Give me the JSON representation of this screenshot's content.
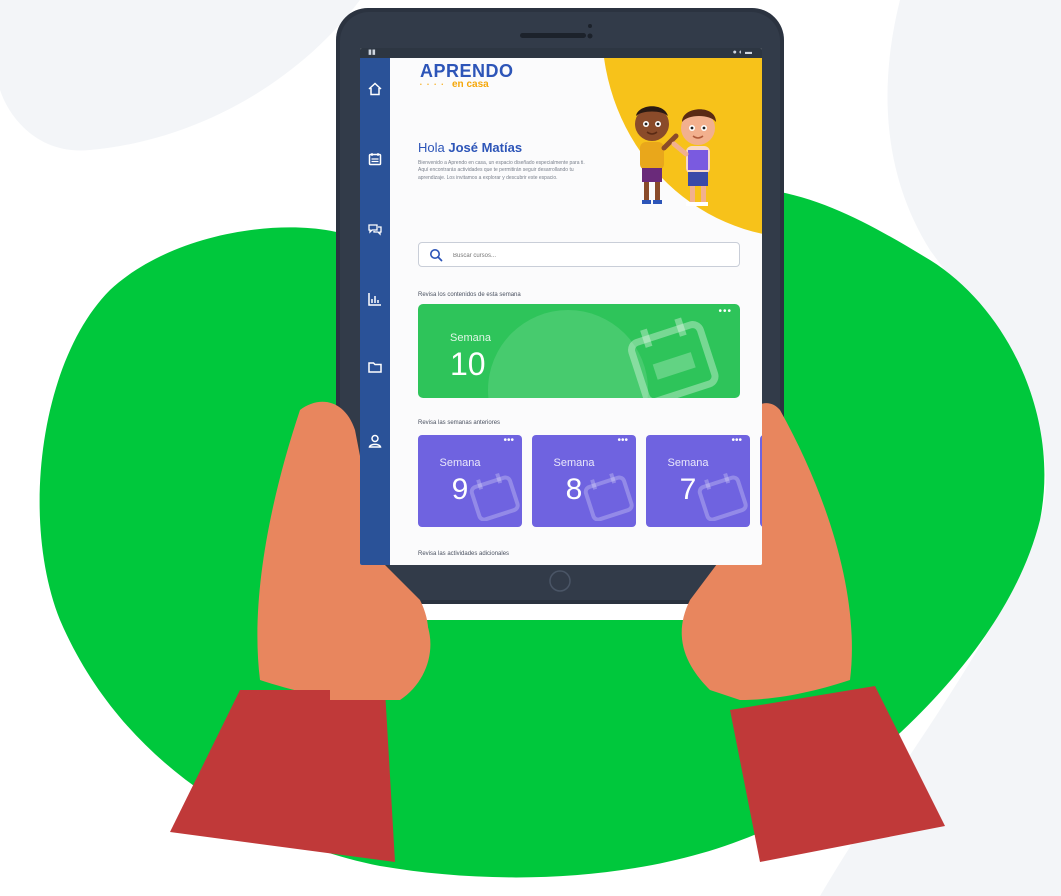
{
  "app": {
    "logo_main": "APRENDO",
    "logo_sub": "en casa"
  },
  "header": {
    "greeting_prefix": "Hola ",
    "user_name": "José Matías",
    "intro_text": "Bienvenido a Aprendo en casa, un espacio diseñado especialmente para ti. Aquí encontrarás actividades que te permitirán seguir desarrollando tu aprendizaje. Los invitamos a explorar y descubrir este espacio."
  },
  "search": {
    "placeholder": "Buscar cursos..."
  },
  "sections": {
    "current_week_label": "Revisa los contenidos de esta semana",
    "previous_weeks_label": "Revisa las semanas anteriores",
    "additional_label": "Revisa las actividades adicionales"
  },
  "current_week": {
    "label": "Semana",
    "number": "10",
    "more": "•••"
  },
  "previous_weeks": [
    {
      "label": "Semana",
      "number": "9",
      "more": "•••"
    },
    {
      "label": "Semana",
      "number": "8",
      "more": "•••"
    },
    {
      "label": "Semana",
      "number": "7",
      "more": "•••"
    }
  ],
  "sidebar": {
    "items": [
      {
        "icon": "home-icon"
      },
      {
        "icon": "calendar-icon"
      },
      {
        "icon": "chat-icon"
      },
      {
        "icon": "chart-icon"
      },
      {
        "icon": "folder-icon"
      },
      {
        "icon": "user-icon"
      }
    ]
  },
  "colors": {
    "sidebar": "#2a5298",
    "brand_blue": "#2d55b8",
    "current_week": "#2ec45a",
    "previous_week": "#6f63e0",
    "yellow": "#f7c21a",
    "background_blob": "#00c83c"
  }
}
